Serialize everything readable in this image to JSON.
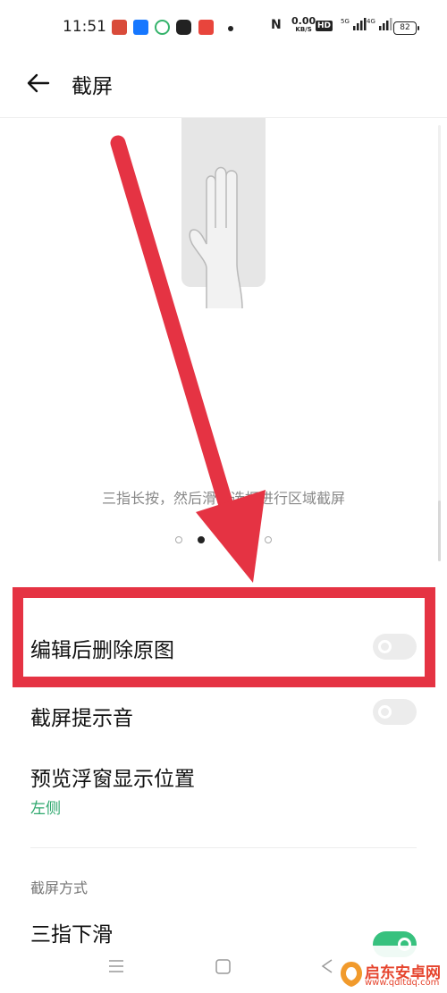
{
  "status_bar": {
    "time": "11:51",
    "net_speed_value": "0.00",
    "net_speed_unit": "KB/S",
    "hd_label": "HD",
    "signal_5g": "5G",
    "signal_4g": "4G",
    "battery": "82"
  },
  "header": {
    "title": "截屏"
  },
  "carousel": {
    "caption": "三指长按，然后滑动选框进行区域截屏",
    "page_count": 5,
    "active_index": 1
  },
  "settings": {
    "delete_after_edit": {
      "label": "编辑后删除原图",
      "enabled": false
    },
    "screenshot_sound": {
      "label": "截屏提示音",
      "enabled": false
    },
    "preview_position": {
      "label": "预览浮窗显示位置",
      "value": "左侧"
    },
    "section_title": "截屏方式",
    "three_finger_swipe": {
      "label": "三指下滑",
      "enabled": true
    }
  },
  "watermark": {
    "name": "启东安卓网",
    "url": "www.qdltdq.com"
  },
  "colors": {
    "accent_green": "#37c17e",
    "annotation_red": "#e53343",
    "secondary_text": "#888888"
  }
}
